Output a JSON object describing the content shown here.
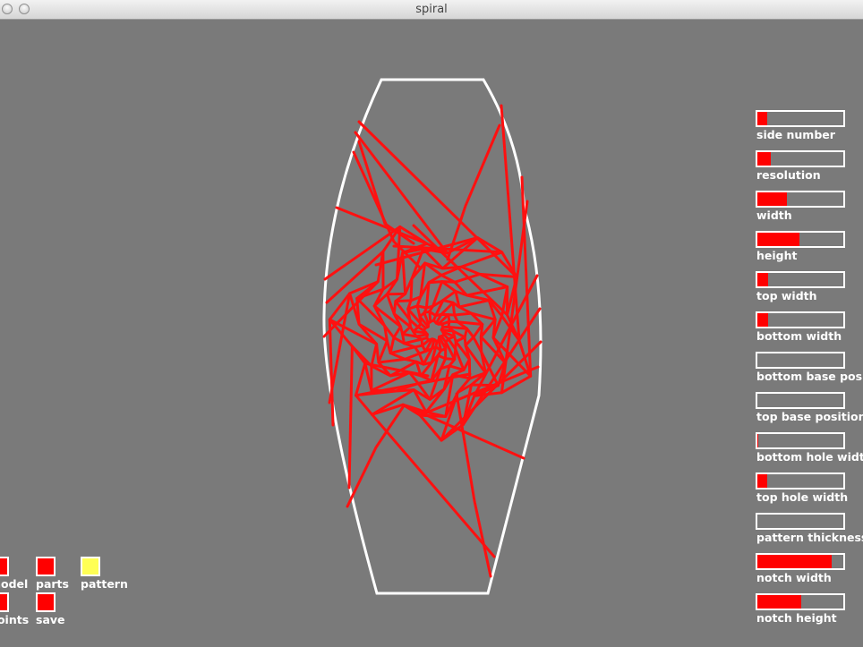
{
  "window": {
    "title": "spiral"
  },
  "colors": {
    "background": "#7a7a7a",
    "accent": "#ff0000",
    "outline": "#ffffff",
    "highlight": "#ffff55"
  },
  "sliders": [
    {
      "label": "side number",
      "fill": 0.11
    },
    {
      "label": "resolution",
      "fill": 0.16
    },
    {
      "label": "width",
      "fill": 0.34
    },
    {
      "label": "height",
      "fill": 0.49
    },
    {
      "label": "top width",
      "fill": 0.12
    },
    {
      "label": "bottom width",
      "fill": 0.12
    },
    {
      "label": "bottom base position",
      "fill": 0.0
    },
    {
      "label": "top base position",
      "fill": 0.0
    },
    {
      "label": "bottom hole width",
      "fill": 0.01
    },
    {
      "label": "top hole width",
      "fill": 0.11
    },
    {
      "label": "pattern thickness",
      "fill": 0.0
    },
    {
      "label": "notch width",
      "fill": 0.86
    },
    {
      "label": "notch height",
      "fill": 0.51
    }
  ],
  "toggles": [
    {
      "label": "model",
      "color": "#ff0000"
    },
    {
      "label": "parts",
      "color": "#ff0000"
    },
    {
      "label": "pattern",
      "color": "#ffff55"
    },
    {
      "label": "points",
      "color": "#ff0000"
    },
    {
      "label": "save",
      "color": "#ff0000"
    }
  ]
}
